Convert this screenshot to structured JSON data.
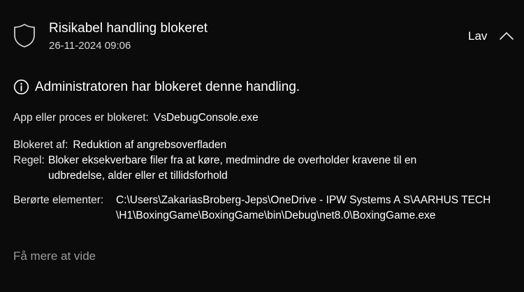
{
  "notification": {
    "title": "Risikabel handling blokeret",
    "timestamp": "26-11-2024 09:06",
    "severity": "Lav",
    "icons": {
      "header": "shield-icon",
      "collapse": "chevron-up-icon",
      "info": "info-icon"
    }
  },
  "summary": {
    "text": "Administratoren har blokeret denne handling."
  },
  "details": {
    "app_label": "App eller proces er blokeret:",
    "app_value": "VsDebugConsole.exe",
    "blocked_by_label": "Blokeret af:",
    "blocked_by_value": "Reduktion af angrebsoverfladen",
    "rule_label": "Regel:",
    "rule_value_line1": "Bloker eksekverbare filer fra at køre, medmindre de overholder kravene til en",
    "rule_value_line2": "udbredelse, alder eller et tillidsforhold",
    "affected_label": "Berørte elementer:",
    "affected_value_line1": "C:\\Users\\ZakariasBroberg-Jeps\\OneDrive - IPW Systems A S\\AARHUS TECH",
    "affected_value_line2": "\\H1\\BoxingGame\\BoxingGame\\bin\\Debug\\net8.0\\BoxingGame.exe"
  },
  "footer": {
    "learn_more": "Få mere at vide"
  },
  "colors": {
    "background": "#0b0b0b",
    "text": "#ffffff",
    "muted": "#9a9a9a"
  }
}
